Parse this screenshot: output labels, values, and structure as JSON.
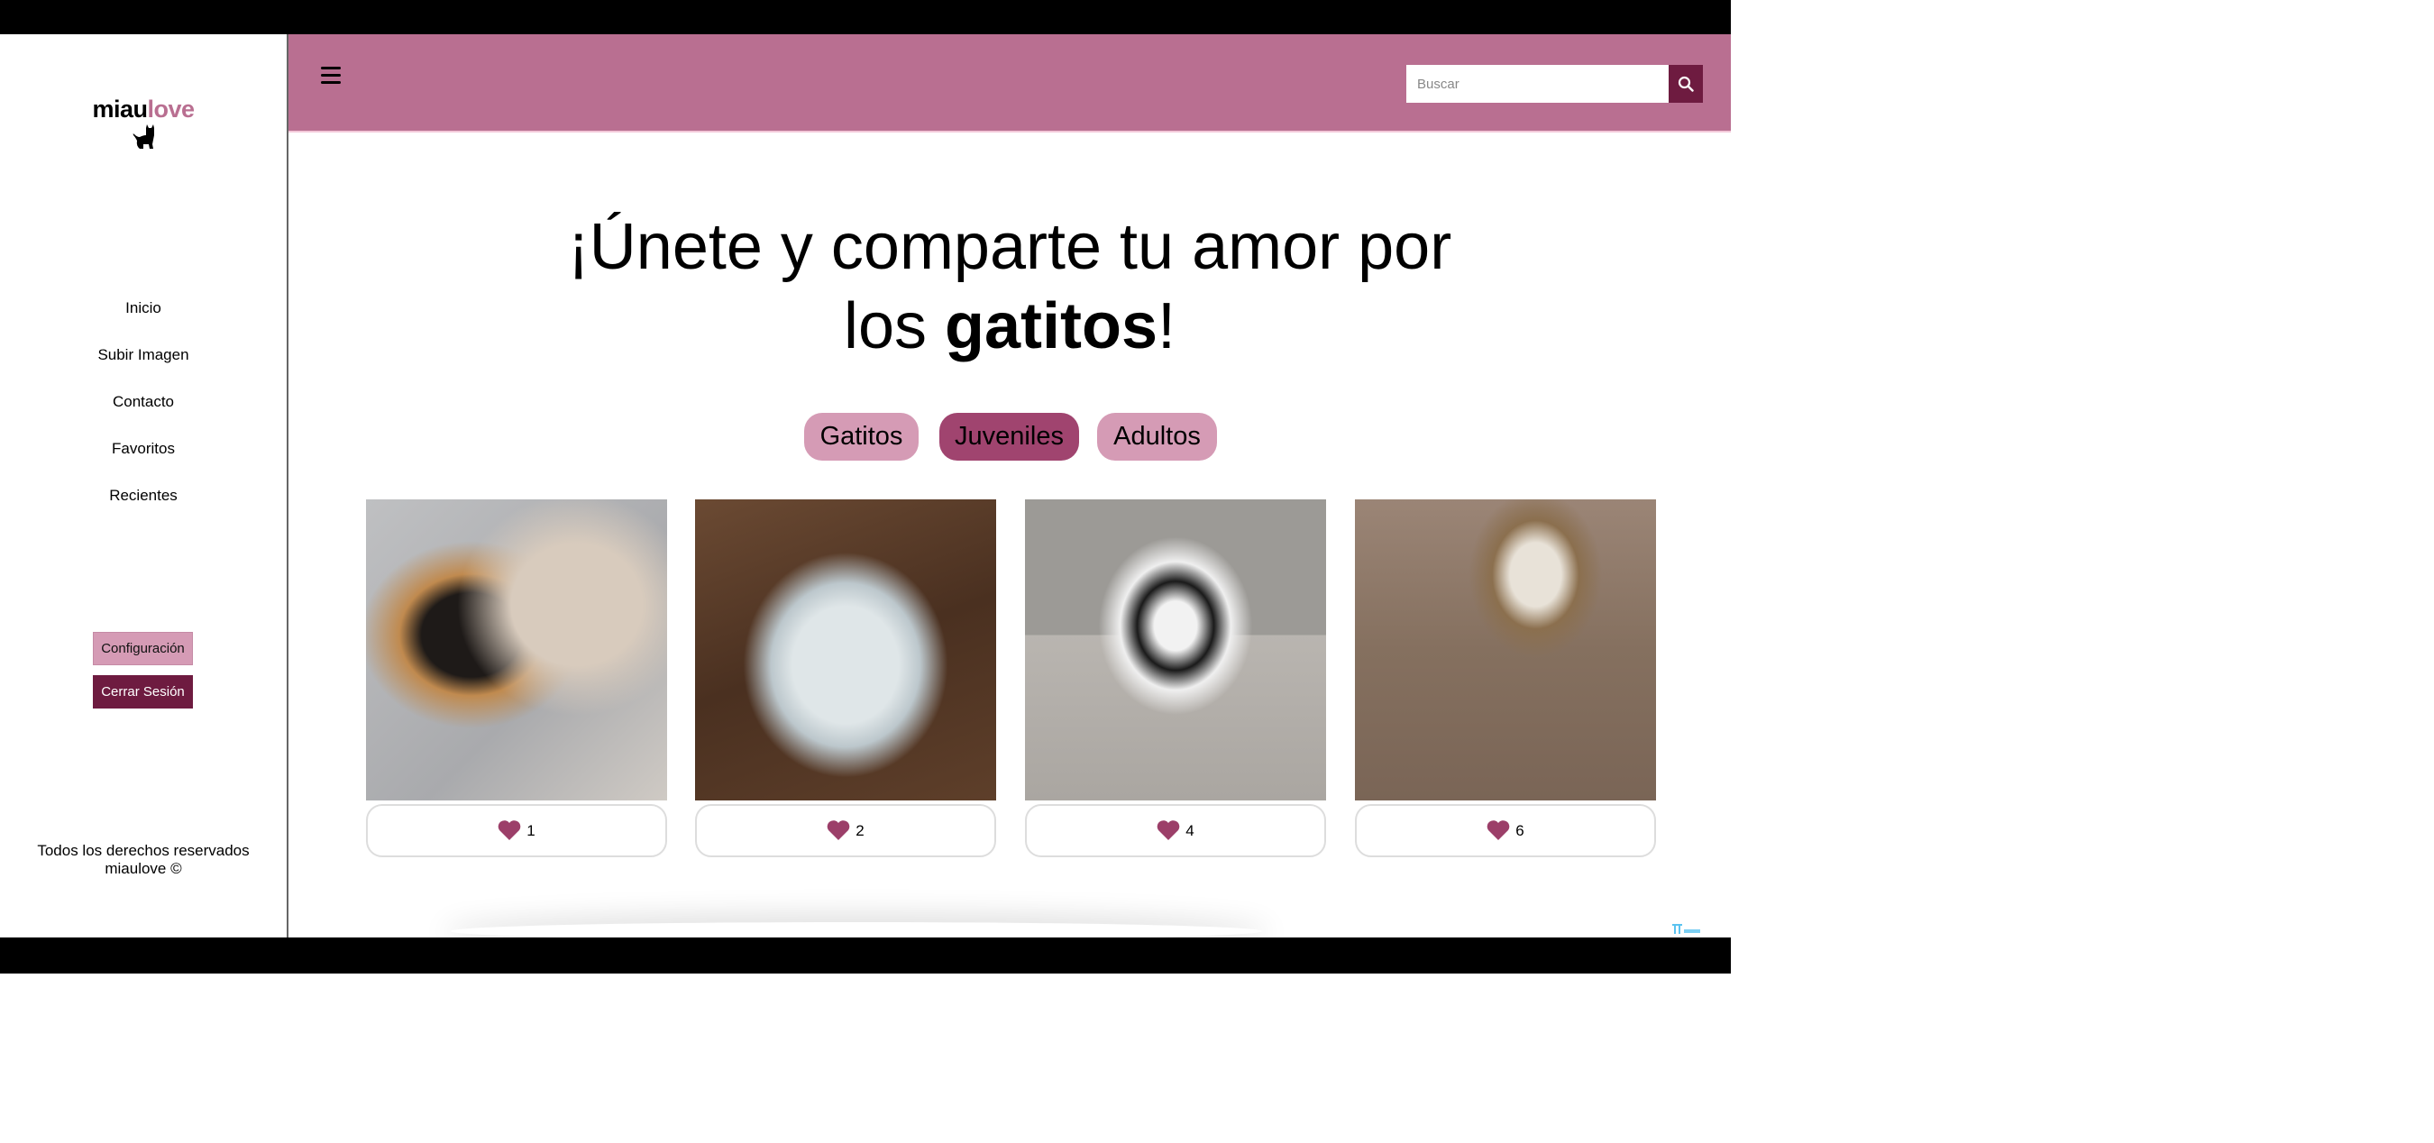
{
  "brand": {
    "part1": "miau",
    "part2": "love",
    "accent": "#b96f91",
    "logo_icon": "cat-icon"
  },
  "sidebar": {
    "items": [
      {
        "label": "Inicio"
      },
      {
        "label": "Subir Imagen"
      },
      {
        "label": "Contacto"
      },
      {
        "label": "Favoritos"
      },
      {
        "label": "Recientes"
      }
    ],
    "config_label": "Configuración",
    "logout_label": "Cerrar Sesión",
    "footer_line1": "Todos los derechos reservados",
    "footer_line2": "miaulove ©"
  },
  "header": {
    "menu_icon": "hamburger-icon",
    "search_placeholder": "Buscar",
    "search_icon": "search-icon",
    "bg": "#b96f91",
    "button_bg": "#6e1b40"
  },
  "hero": {
    "line1": "¡Únete y comparte tu amor por",
    "line2_pre": "los ",
    "line2_bold": "gatitos",
    "line2_post": "!"
  },
  "filters": [
    {
      "label": "Gatitos",
      "active": false
    },
    {
      "label": "Juveniles",
      "active": true
    },
    {
      "label": "Adultos",
      "active": false
    }
  ],
  "cards": [
    {
      "likes": "1"
    },
    {
      "likes": "2"
    },
    {
      "likes": "4"
    },
    {
      "likes": "6"
    }
  ],
  "colors": {
    "heart": "#9c3f69",
    "filter": "#d59bb5",
    "filter_active": "#a0446f"
  }
}
